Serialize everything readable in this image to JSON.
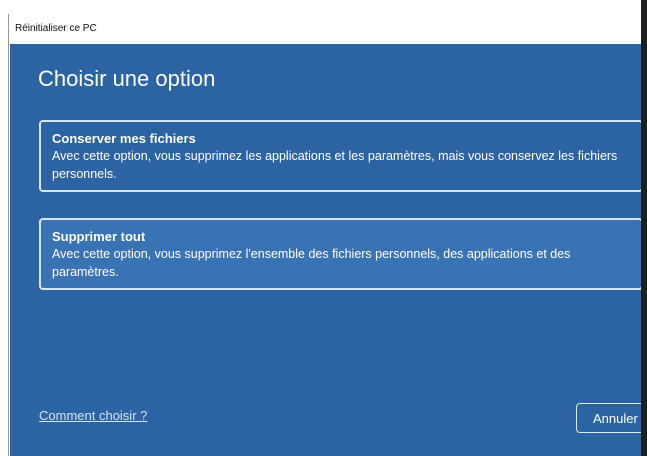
{
  "window": {
    "title": "Réinitialiser ce PC"
  },
  "main": {
    "heading": "Choisir une option",
    "options": [
      {
        "title": "Conserver mes fichiers",
        "description": "Avec cette option, vous supprimez les applications et les paramètres, mais vous conservez les fichiers personnels."
      },
      {
        "title": "Supprimer tout",
        "description": "Avec cette option, vous supprimez l'ensemble des fichiers personnels, des applications et des paramètres."
      }
    ]
  },
  "footer": {
    "help_link": "Comment choisir ?",
    "cancel_label": "Annuler"
  },
  "colors": {
    "background": "#2b63a3",
    "highlight": "#3a73b3",
    "border": "#d9e4f1",
    "text": "#ffffff"
  }
}
